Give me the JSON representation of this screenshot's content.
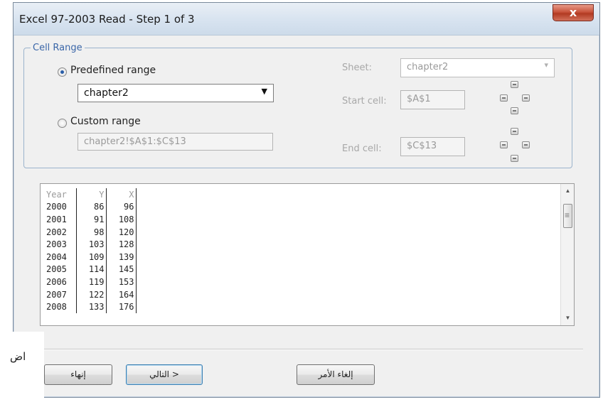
{
  "window": {
    "title": "Excel 97-2003 Read - Step 1 of 3",
    "close_glyph": "x"
  },
  "cell_range": {
    "legend": "Cell Range",
    "predefined_label": "Predefined range",
    "predefined_selected": "chapter2",
    "custom_label": "Custom range",
    "custom_value": "chapter2!$A$1:$C$13",
    "sheet_label": "Sheet:",
    "sheet_value": "chapter2",
    "start_label": "Start cell:",
    "start_value": "$A$1",
    "end_label": "End cell:",
    "end_value": "$C$13"
  },
  "preview": {
    "header": [
      "Year",
      "Y",
      "X"
    ],
    "rows": [
      [
        "2000",
        "86",
        "96"
      ],
      [
        "2001",
        "91",
        "108"
      ],
      [
        "2002",
        "98",
        "120"
      ],
      [
        "2003",
        "103",
        "128"
      ],
      [
        "2004",
        "109",
        "139"
      ],
      [
        "2005",
        "114",
        "145"
      ],
      [
        "2006",
        "119",
        "153"
      ],
      [
        "2007",
        "122",
        "164"
      ],
      [
        "2008",
        "133",
        "176"
      ]
    ]
  },
  "buttons": {
    "finish": "إنهاء",
    "next": "التالي >",
    "cancel": "إلغاء الأمر"
  },
  "overlay_text": "اض",
  "icons": {
    "radio": "radio-icon",
    "dropdown": "chevron-down-icon",
    "nav": "nav-arrows-icon"
  }
}
